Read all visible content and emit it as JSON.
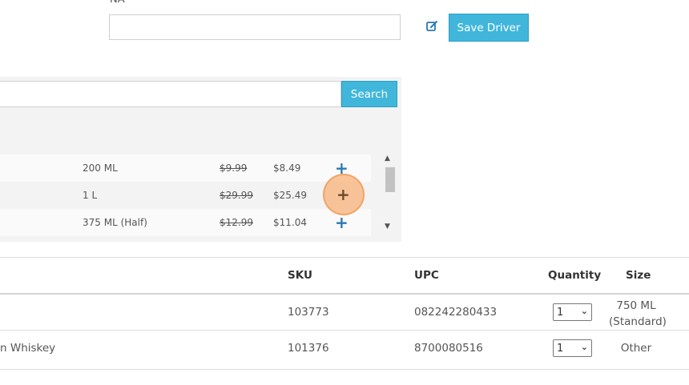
{
  "driver": {
    "label": "NA",
    "input_value": "",
    "save_label": "Save Driver"
  },
  "search": {
    "input_value": "",
    "button_label": "Search"
  },
  "results": [
    {
      "size": "200 ML",
      "old_price": "$9.99",
      "new_price": "$8.49",
      "add": "+"
    },
    {
      "size": "1 L",
      "old_price": "$29.99",
      "new_price": "$25.49",
      "add": "+"
    },
    {
      "size": "375 ML (Half)",
      "old_price": "$12.99",
      "new_price": "$11.04",
      "add": "+"
    }
  ],
  "table": {
    "headers": {
      "sku": "SKU",
      "upc": "UPC",
      "quantity": "Quantity",
      "size": "Size"
    },
    "rows": [
      {
        "name": "",
        "sku": "103773",
        "upc": "082242280433",
        "quantity": "1",
        "size_line1": "750 ML",
        "size_line2": "(Standard)"
      },
      {
        "name": "n Whiskey",
        "sku": "101376",
        "upc": "8700080516",
        "quantity": "1",
        "size_line1": "Other",
        "size_line2": ""
      }
    ]
  },
  "colors": {
    "accent": "#41b6db",
    "add_icon": "#2a78b5",
    "highlight": "#f8b178"
  }
}
